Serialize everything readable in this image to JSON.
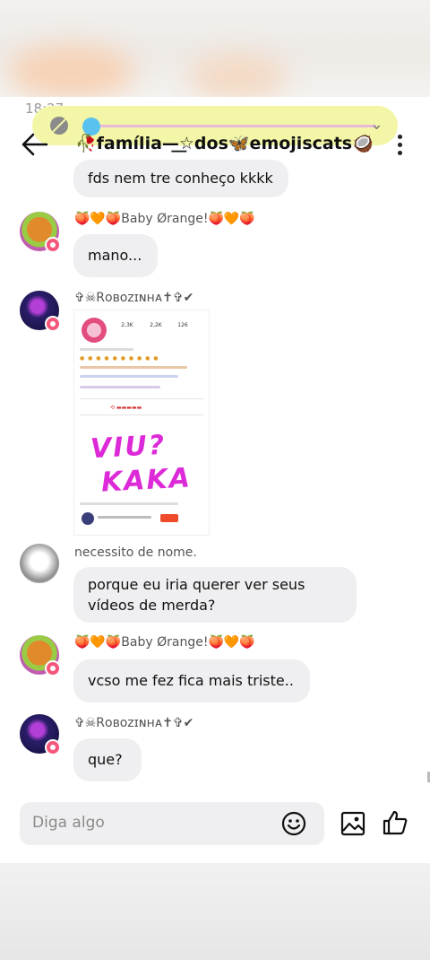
{
  "status": {
    "time": "18:27",
    "right": ""
  },
  "header": {
    "title": "🥀família—͟☆dos🦋emojiscats🥥"
  },
  "messages": [
    {
      "id": "m0",
      "text": "fds nem tre conheço kkkk"
    },
    {
      "id": "m1",
      "sender": "🍑🧡🍑Baby Ørange!🍑🧡🍑",
      "text": "mano..."
    },
    {
      "id": "m2",
      "sender": "✞☠︎Rᴏʙᴏᴢɪɴʜᴀ✝︎✞✔"
    },
    {
      "id": "m3",
      "sender": "necessito de nome.",
      "text": "porque eu iria querer ver seus vídeos de merda?"
    },
    {
      "id": "m4",
      "sender": "🍑🧡🍑Baby Ørange!🍑🧡🍑",
      "text": "vcso me fez fica mais triste.."
    },
    {
      "id": "m5",
      "sender": "✞☠︎Rᴏʙᴏᴢɪɴʜᴀ✝︎✞✔",
      "text": "que?"
    }
  ],
  "shared_image": {
    "stats": [
      "2,3K",
      "2,2K",
      "126"
    ],
    "handwriting_line1": "VIU?",
    "handwriting_line2": "KAKA"
  },
  "composer": {
    "placeholder": "Diga algo"
  },
  "icons": [
    "back-arrow-icon",
    "more-vert-icon",
    "emoji-icon",
    "gallery-icon",
    "like-icon",
    "mute-icon",
    "chevron-down-icon"
  ]
}
